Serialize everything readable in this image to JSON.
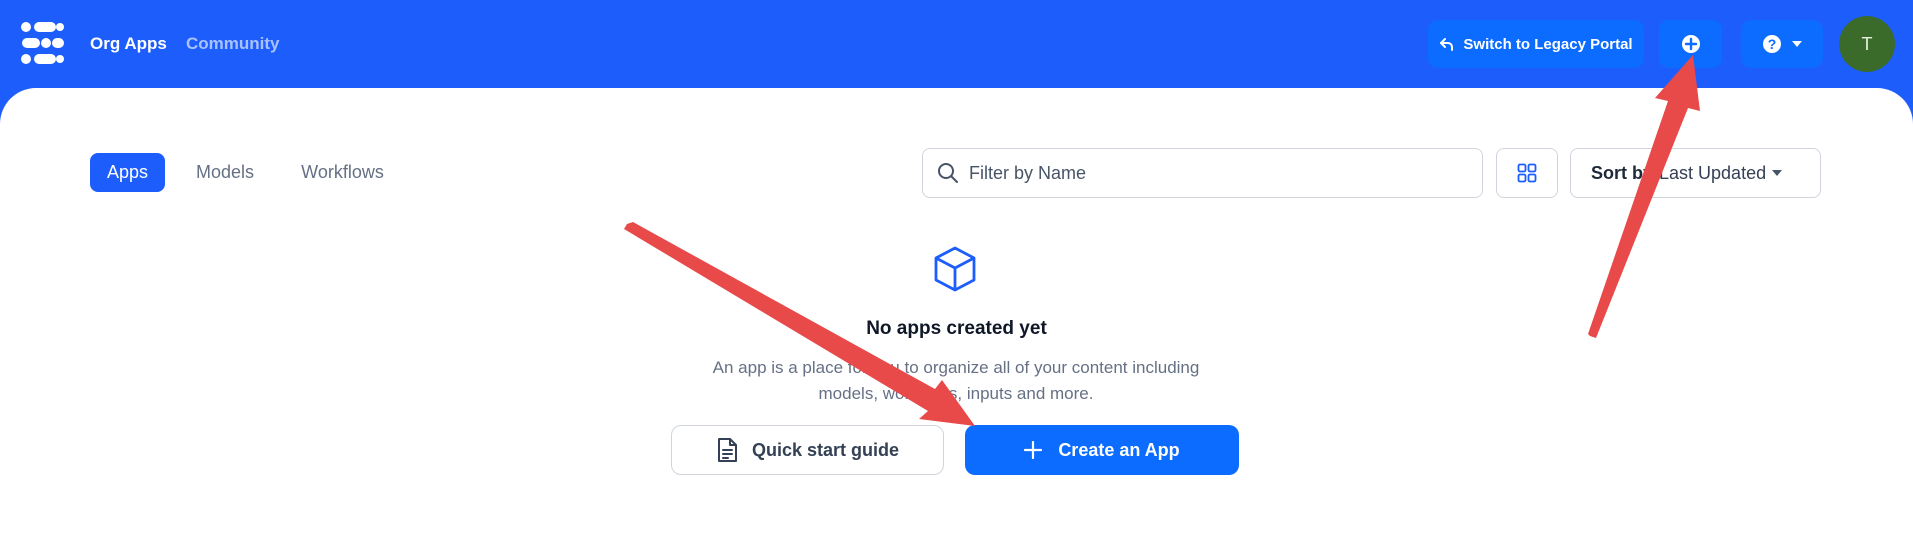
{
  "header": {
    "nav": {
      "org_apps": "Org Apps",
      "community": "Community"
    },
    "legacy_button": "Switch to Legacy Portal",
    "avatar_initial": "T"
  },
  "tabs": [
    {
      "label": "Apps",
      "active": true
    },
    {
      "label": "Models",
      "active": false
    },
    {
      "label": "Workflows",
      "active": false
    }
  ],
  "toolbar": {
    "search_placeholder": "Filter by Name",
    "sort_prefix": "Sort by",
    "sort_value": "Last Updated"
  },
  "empty_state": {
    "title": "No apps created yet",
    "description": "An app is a place for you to organize all of your content including models, workflows, inputs and more.",
    "quick_start_label": "Quick start guide",
    "create_label": "Create an App"
  },
  "icons": {
    "logo": "clarifai-logo-icon",
    "legacy": "undo-arrow-icon",
    "add": "plus-circle-icon",
    "help": "question-circle-icon",
    "grid": "grid-view-icon",
    "search": "search-icon",
    "cube": "cube-icon",
    "doc": "document-icon",
    "plus": "plus-icon"
  },
  "colors": {
    "brand": "#1d5dfc",
    "button": "#0b6cff",
    "avatar": "#3b6b2b",
    "annotation_arrow": "#e84a4a"
  }
}
